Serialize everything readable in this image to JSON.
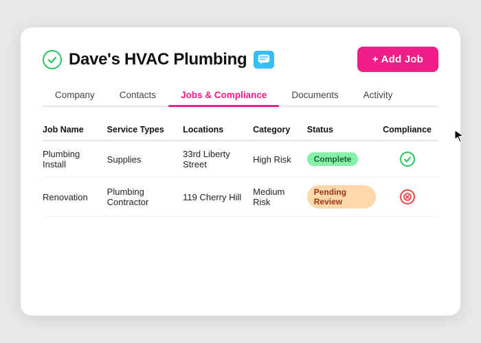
{
  "header": {
    "company_name": "Dave's HVAC Plumbing",
    "check_icon": "check-circle-icon",
    "chat_icon": "chat-icon",
    "add_job_label": "+ Add Job"
  },
  "tabs": [
    {
      "label": "Company",
      "active": false
    },
    {
      "label": "Contacts",
      "active": false
    },
    {
      "label": "Jobs & Compliance",
      "active": true
    },
    {
      "label": "Documents",
      "active": false
    },
    {
      "label": "Activity",
      "active": false
    }
  ],
  "table": {
    "columns": [
      {
        "label": "Job Name"
      },
      {
        "label": "Service Types"
      },
      {
        "label": "Locations"
      },
      {
        "label": "Category"
      },
      {
        "label": "Status"
      },
      {
        "label": "Compliance"
      }
    ],
    "rows": [
      {
        "job_name": "Plumbing Install",
        "service_types": "Supplies",
        "locations": "33rd Liberty Street",
        "category": "High  Risk",
        "status": "Complete",
        "status_type": "complete",
        "compliance": "ok"
      },
      {
        "job_name": "Renovation",
        "service_types": "Plumbing Contractor",
        "locations": "119 Cherry Hill",
        "category": "Medium Risk",
        "status": "Pending Review",
        "status_type": "pending",
        "compliance": "fail"
      }
    ]
  }
}
